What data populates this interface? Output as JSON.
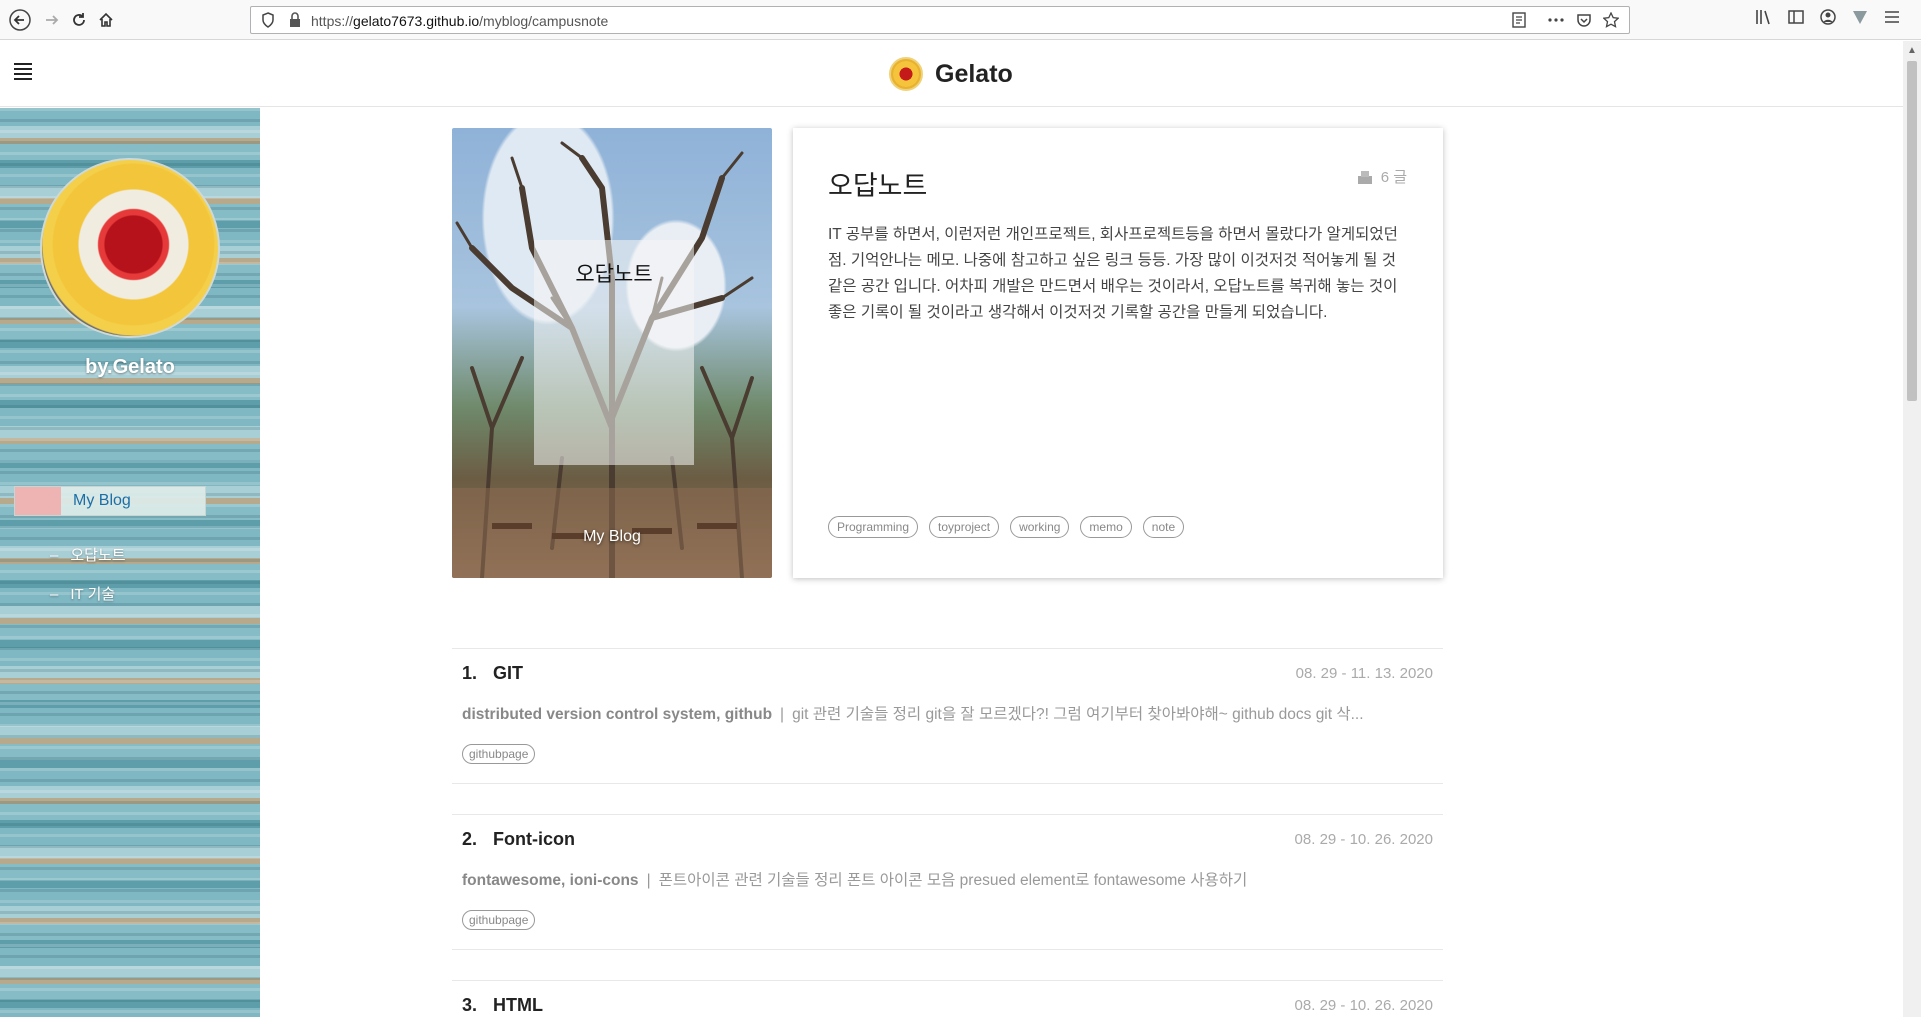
{
  "browser": {
    "url_scheme": "https://",
    "url_host": "gelato7673.github.io",
    "url_path": "/myblog/campusnote"
  },
  "header": {
    "brand_name": "Gelato"
  },
  "sidebar": {
    "byline": "by.Gelato",
    "blog_link": "My Blog",
    "items": [
      {
        "label": "오답노트"
      },
      {
        "label": "IT 기술"
      }
    ]
  },
  "category": {
    "cover_title": "오답노트",
    "cover_subtitle": "My Blog",
    "title": "오답노트",
    "post_count": "6 글",
    "description": "IT 공부를 하면서, 이런저런 개인프로젝트, 회사프로젝트등을 하면서 몰랐다가 알게되었던 점. 기억안나는 메모. 나중에 참고하고 싶은 링크 등등. 가장 많이 이것저것 적어놓게 될 것 같은 공간 입니다. 어차피 개발은 만드면서 배우는 것이라서, 오답노트를 복귀해 놓는 것이 좋은 기록이 될 것이라고 생각해서 이것저것 기록할 공간을 만들게 되었습니다.",
    "tags": [
      "Programming",
      "toyproject",
      "working",
      "memo",
      "note"
    ]
  },
  "posts": [
    {
      "number": "1.",
      "title": "GIT",
      "date": "08. 29 - 11. 13. 2020",
      "keywords": "distributed version control system, github",
      "separator": "|",
      "summary": "git 관련 기술들 정리 git을 잘 모르겠다?! 그럼 여기부터 찾아봐야해~ github docs git 삭...",
      "tag": "githubpage"
    },
    {
      "number": "2.",
      "title": "Font-icon",
      "date": "08. 29 - 10. 26. 2020",
      "keywords": "fontawesome, ioni-cons",
      "separator": "|",
      "summary": "폰트아이콘 관련 기술들 정리 폰트 아이콘 모음 presued element로 fontawesome 사용하기",
      "tag": "githubpage"
    },
    {
      "number": "3.",
      "title": "HTML",
      "date": "08. 29 - 10. 26. 2020"
    }
  ],
  "icons": {
    "back": "back-arrow-icon",
    "forward": "forward-arrow-icon",
    "reload": "reload-icon",
    "home": "home-icon",
    "menu": "hamburger-menu-icon",
    "posts": "document-stack-icon"
  }
}
